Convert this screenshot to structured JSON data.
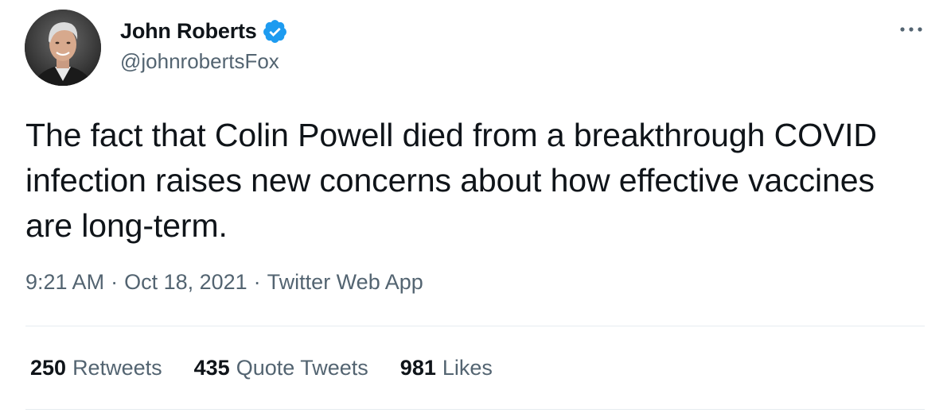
{
  "author": {
    "display_name": "John Roberts",
    "handle": "@johnrobertsFox",
    "verified_icon": "verified-badge-icon",
    "avatar_icon": "avatar"
  },
  "tweet": {
    "text": "The fact that Colin Powell died from a breakthrough COVID infection raises new concerns about how effective vaccines are long-term.",
    "time": "9:21 AM",
    "date": "Oct 18, 2021",
    "source": "Twitter Web App",
    "separator": "·"
  },
  "stats": {
    "retweets_count": "250",
    "retweets_label": "Retweets",
    "quotes_count": "435",
    "quotes_label": "Quote Tweets",
    "likes_count": "981",
    "likes_label": "Likes"
  },
  "colors": {
    "text_primary": "#0f1419",
    "text_secondary": "#536471",
    "verified_blue": "#1d9bf0",
    "divider": "#e6ecf0"
  },
  "icons": {
    "more": "more-options-icon"
  }
}
